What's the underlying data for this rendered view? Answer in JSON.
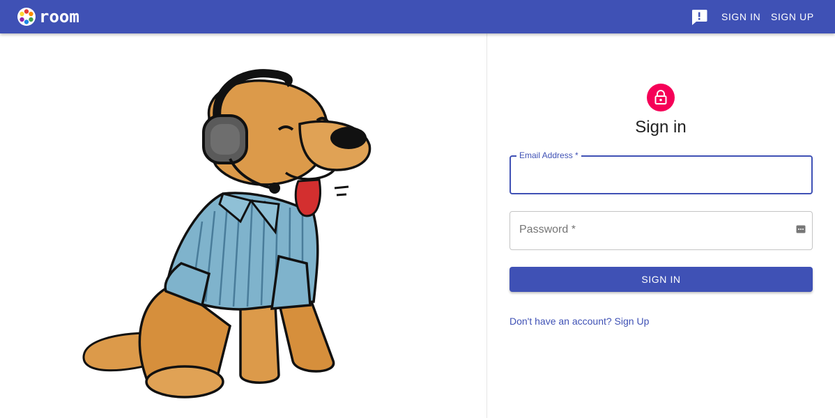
{
  "appbar": {
    "brand": "room",
    "feedback_icon": "feedback-icon",
    "nav": {
      "sign_in": "SIGN IN",
      "sign_up": "SIGN UP"
    },
    "color": "#3f51b5"
  },
  "illustration": {
    "subject": "cartoon dog wearing headset and striped shirt"
  },
  "form": {
    "lock_icon": "lock-icon",
    "lock_color": "#f50057",
    "title": "Sign in",
    "email_label": "Email Address *",
    "email_value": "",
    "password_label": "Password *",
    "password_value": "",
    "password_icon": "password-manager-icon",
    "submit_label": "SIGN IN",
    "signup_link": "Don't have an account? Sign Up"
  }
}
